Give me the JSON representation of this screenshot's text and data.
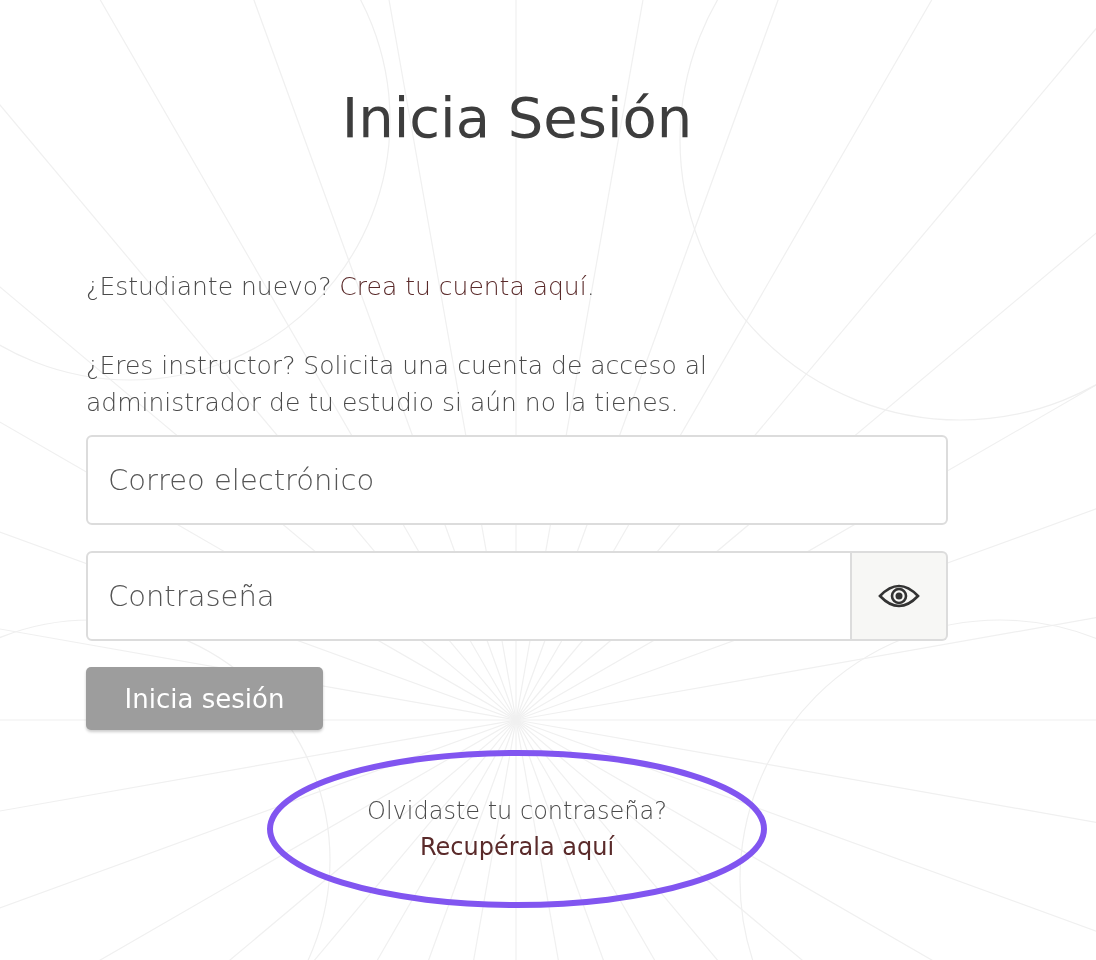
{
  "title": "Inicia Sesión",
  "new_student": {
    "text": "¿Estudiante nuevo?",
    "link": "Crea tu cuenta aquí",
    "after": "."
  },
  "instructor_note": "¿Eres instructor? Solicita una cuenta de acceso al administrador de tu estudio si aún no la tienes.",
  "email_field": {
    "placeholder": "Correo electrónico"
  },
  "password_field": {
    "placeholder": "Contraseña"
  },
  "submit_button": {
    "label": "Inicia sesión",
    "disabled": true
  },
  "forgot": {
    "text": "Olvidaste tu contraseña?",
    "link": "Recupérala aquí"
  }
}
